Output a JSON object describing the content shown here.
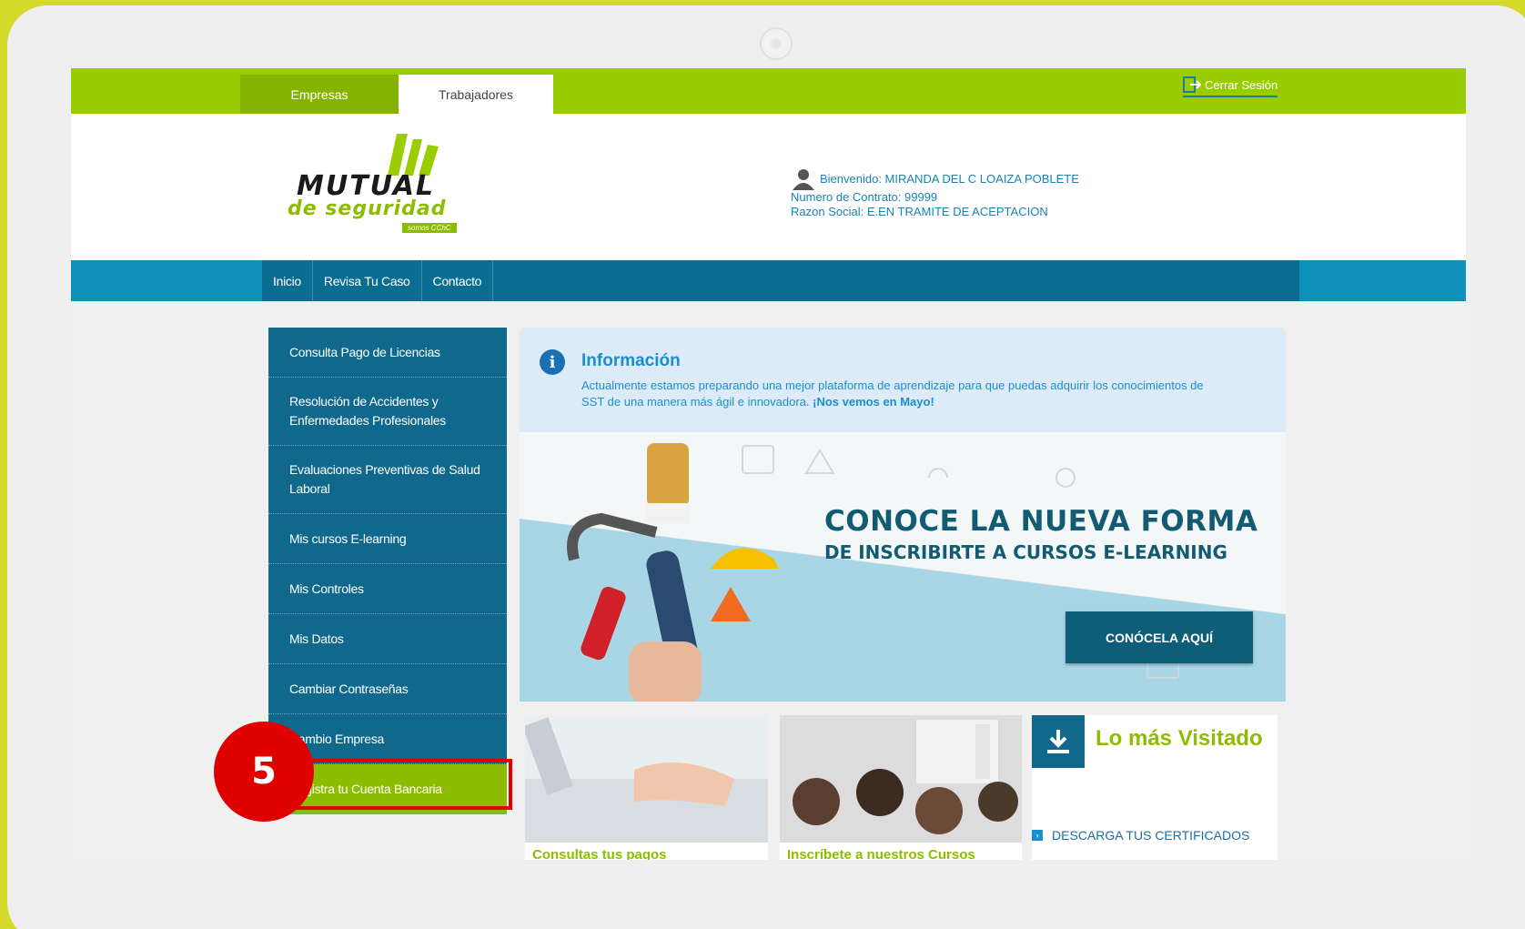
{
  "tabs": {
    "empresas": "Empresas",
    "trabajadores": "Trabajadores"
  },
  "logout_label": "Cerrar Sesión",
  "logo": {
    "brand": "MUTUAL",
    "sub": "de seguridad",
    "tag": "somos CChC"
  },
  "welcome": {
    "line1": "Bienvenido: MIRANDA DEL C LOAIZA POBLETE",
    "line2": "Numero de Contrato: 99999",
    "line3": "Razon Social: E.EN TRAMITE DE ACEPTACION"
  },
  "nav": [
    "Inicio",
    "Revisa Tu Caso",
    "Contacto"
  ],
  "sidebar": {
    "items": [
      {
        "label": "Consulta Pago de Licencias"
      },
      {
        "label": "Resolución de Accidentes y Enfermedades Profesionales"
      },
      {
        "label": "Evaluaciones Preventivas de Salud Laboral"
      },
      {
        "label": "Mis cursos E-learning"
      },
      {
        "label": "Mis Controles"
      },
      {
        "label": "Mis Datos"
      },
      {
        "label": "Cambiar Contraseñas"
      },
      {
        "label": "Cambio Empresa"
      },
      {
        "label": "Registra tu Cuenta Bancaria"
      }
    ]
  },
  "step_number": "5",
  "info": {
    "title": "Información",
    "text": "Actualmente estamos preparando una mejor plataforma de aprendizaje para que puedas adquirir los conocimientos de SST de una manera más ágil e innovadora. ",
    "bold": "¡Nos vemos en Mayo!"
  },
  "banner": {
    "title1": "CONOCE LA NUEVA FORMA",
    "title2": "DE INSCRIBIRTE A CURSOS E-LEARNING",
    "button": "CONÓCELA AQUÍ"
  },
  "cards": {
    "card1_caption": "Consultas tus pagos",
    "card2_caption": "Inscríbete a nuestros Cursos",
    "most_visited": "Lo más Visitado",
    "download_link": "DESCARGA TUS CERTIFICADOS"
  },
  "colors": {
    "green": "#9acd00",
    "blue": "#10698c",
    "red": "#e00000"
  }
}
